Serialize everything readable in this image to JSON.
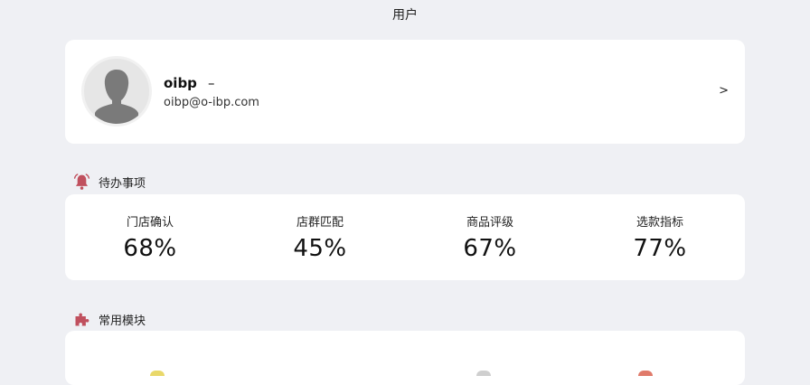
{
  "header": {
    "title": "用户"
  },
  "profile": {
    "name": "oibp",
    "role": "–",
    "email": "oibp@o-ibp.com",
    "chevron": ">"
  },
  "todo": {
    "title": "待办事项",
    "icon": "bell-icon",
    "accent": "#c0505e",
    "metrics": [
      {
        "label": "门店确认",
        "value": "68%"
      },
      {
        "label": "店群匹配",
        "value": "45%"
      },
      {
        "label": "商品评级",
        "value": "67%"
      },
      {
        "label": "选款指标",
        "value": "77%"
      }
    ]
  },
  "modules": {
    "title": "常用模块",
    "icon": "puzzle-icon",
    "accent": "#c0505e"
  }
}
